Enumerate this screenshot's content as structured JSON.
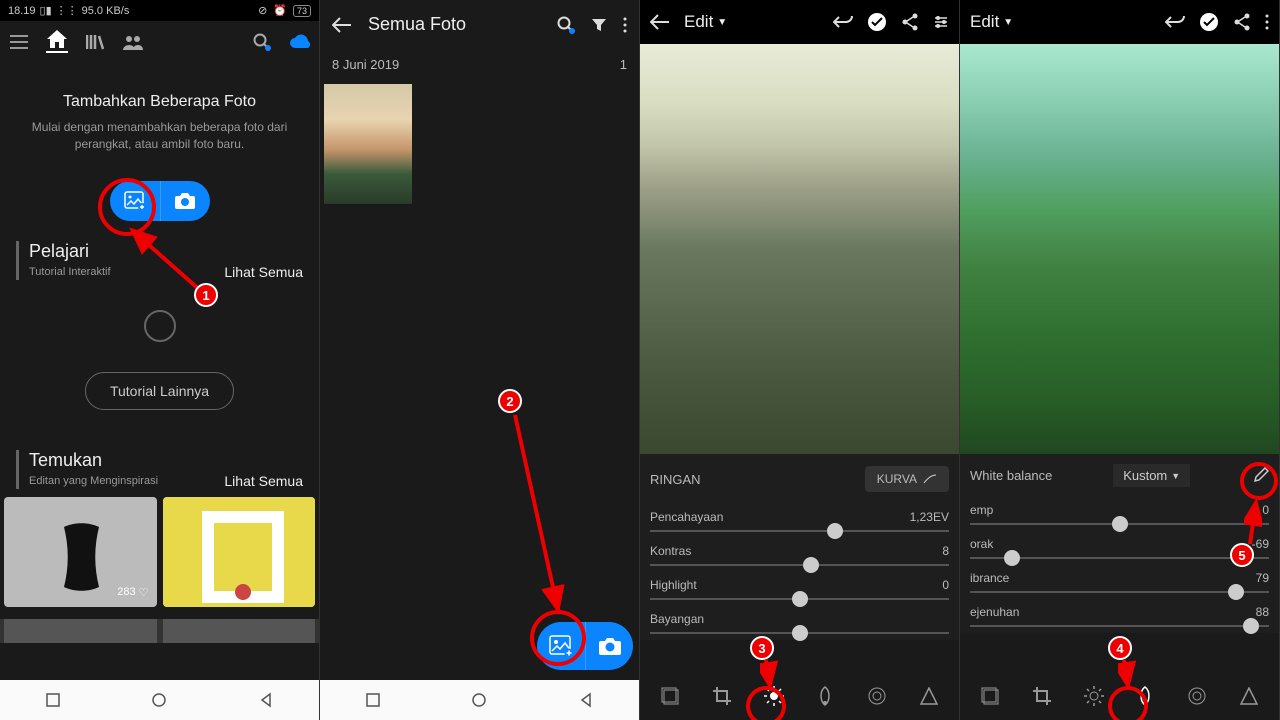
{
  "status": {
    "time": "18.19",
    "net": "95.0 KB/s",
    "battery": "73"
  },
  "p1": {
    "welcome_title": "Tambahkan Beberapa Foto",
    "welcome_sub": "Mulai dengan menambahkan beberapa foto dari perangkat, atau ambil foto baru.",
    "learn": "Pelajari",
    "learn_sub": "Tutorial Interaktif",
    "see_all": "Lihat Semua",
    "more": "Tutorial Lainnya",
    "discover": "Temukan",
    "discover_sub": "Editan yang Menginspirasi",
    "likes": "283"
  },
  "p2": {
    "title": "Semua Foto",
    "date": "8 Juni 2019",
    "count": "1"
  },
  "p3": {
    "edit": "Edit",
    "mode": "RINGAN",
    "curve": "KURVA",
    "sliders": [
      {
        "label": "Pencahayaan",
        "value": "1,23EV",
        "pos": 62
      },
      {
        "label": "Kontras",
        "value": "8",
        "pos": 54
      },
      {
        "label": "Highlight",
        "value": "0",
        "pos": 50
      },
      {
        "label": "Bayangan",
        "value": "",
        "pos": 50
      }
    ]
  },
  "p4": {
    "edit": "Edit",
    "wb": "White balance",
    "wb_val": "Kustom",
    "sliders": [
      {
        "label": "emp",
        "value": "0",
        "pos": 50
      },
      {
        "label": "orak",
        "value": "-69",
        "pos": 14
      },
      {
        "label": "ibrance",
        "value": "79",
        "pos": 89
      },
      {
        "label": "ejenuhan",
        "value": "88",
        "pos": 94
      }
    ]
  },
  "ann": {
    "1": "1",
    "2": "2",
    "3": "3",
    "4": "4",
    "5": "5"
  }
}
